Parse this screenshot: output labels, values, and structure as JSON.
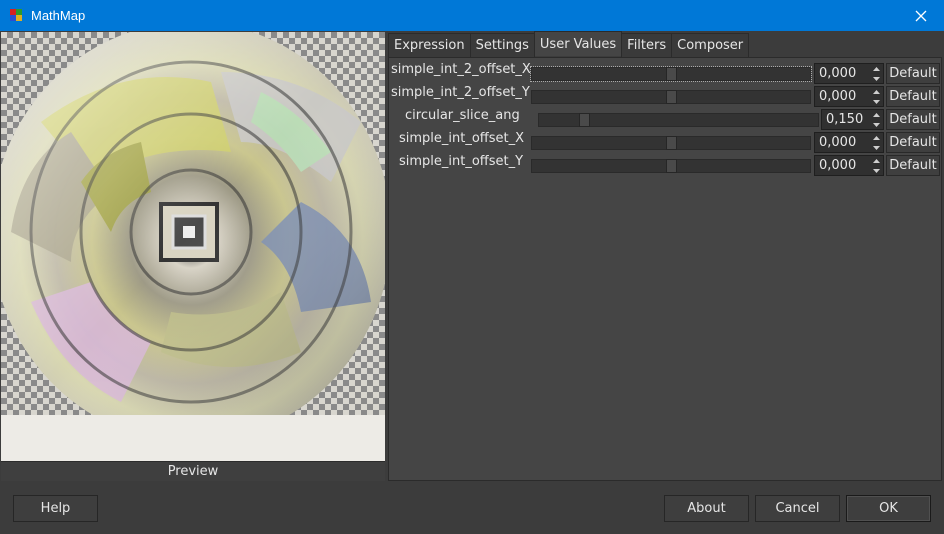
{
  "window": {
    "title": "MathMap",
    "close_glyph": "✕"
  },
  "preview": {
    "label": "Preview"
  },
  "tabs": [
    {
      "label": "Expression"
    },
    {
      "label": "Settings"
    },
    {
      "label": "User Values",
      "active": true
    },
    {
      "label": "Filters"
    },
    {
      "label": "Composer"
    }
  ],
  "params": [
    {
      "name": "simple_int_2_offset_X",
      "value": "0,000",
      "fraction": 0.5
    },
    {
      "name": "simple_int_2_offset_Y",
      "value": "0,000",
      "fraction": 0.5
    },
    {
      "name": "circular_slice_ang",
      "value": "0,150",
      "fraction": 0.15
    },
    {
      "name": "simple_int_offset_X",
      "value": "0,000",
      "fraction": 0.5
    },
    {
      "name": "simple_int_offset_Y",
      "value": "0,000",
      "fraction": 0.5
    }
  ],
  "default_label": "Default",
  "buttons": {
    "help": "Help",
    "about": "About",
    "cancel": "Cancel",
    "ok": "OK"
  },
  "colors": {
    "titlebar": "#0078d7",
    "background": "#3c3c3c",
    "panel": "#454545"
  }
}
